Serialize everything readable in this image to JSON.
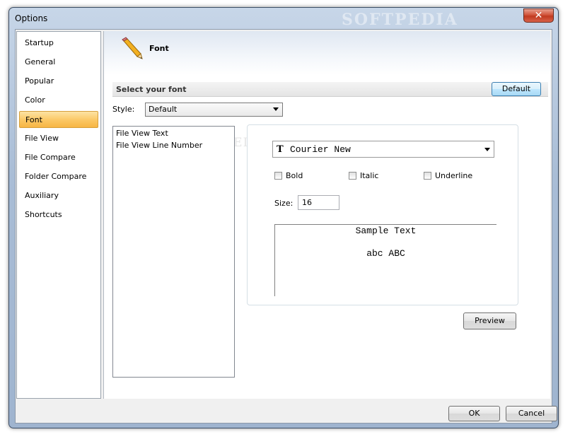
{
  "window": {
    "title": "Options",
    "watermark": "SOFTPEDIA",
    "close_glyph": "✕"
  },
  "nav": {
    "selected": "Font",
    "items": [
      {
        "label": "Startup"
      },
      {
        "label": "General"
      },
      {
        "label": "Popular"
      },
      {
        "label": "Color"
      },
      {
        "label": "Font"
      },
      {
        "label": "File View"
      },
      {
        "label": "File Compare"
      },
      {
        "label": "Folder Compare"
      },
      {
        "label": "Auxiliary"
      },
      {
        "label": "Shortcuts"
      }
    ]
  },
  "header": {
    "title": "Font",
    "icon": "pencil-icon"
  },
  "section": {
    "label": "Select your font",
    "default_button": "Default"
  },
  "style": {
    "label": "Style:",
    "value": "Default"
  },
  "list": {
    "items": [
      "File View Text",
      "File View Line Number"
    ]
  },
  "font": {
    "icon": "truetype-font-icon",
    "icon_glyph": "T",
    "name": "Courier New",
    "bold_label": "Bold",
    "italic_label": "Italic",
    "underline_label": "Underline",
    "bold_checked": false,
    "italic_checked": false,
    "underline_checked": false,
    "size_label": "Size:",
    "size_value": "16",
    "sample_title": "Sample Text",
    "sample_body": "abc ABC"
  },
  "buttons": {
    "preview": "Preview",
    "ok": "OK",
    "cancel": "Cancel"
  }
}
